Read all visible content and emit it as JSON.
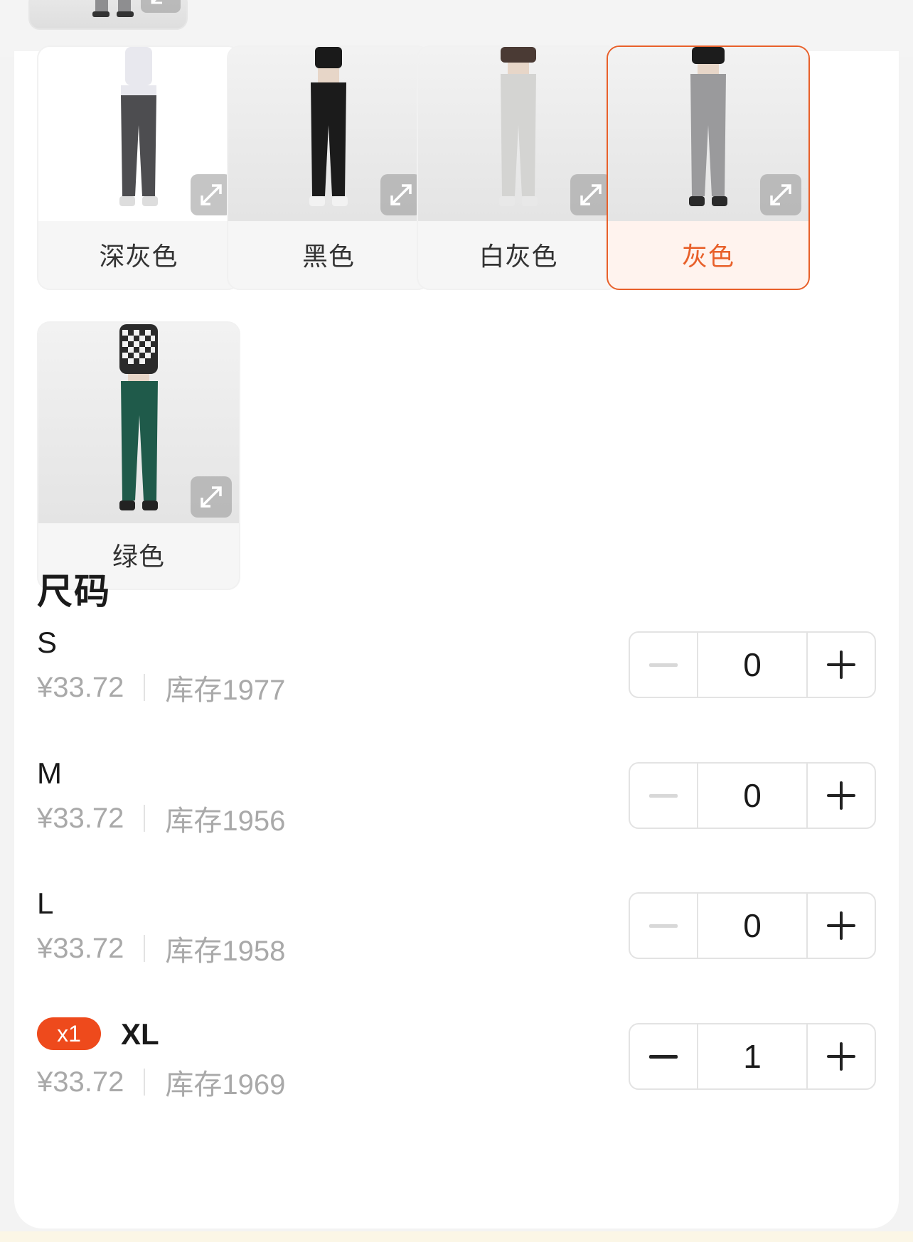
{
  "colors": {
    "accent": "#e8602a",
    "badge": "#ee4a1c",
    "muted_text": "#a9a9a9"
  },
  "color_options": {
    "items": [
      {
        "label": "深灰色",
        "selected": false,
        "pants_color": "#4d4d50",
        "top_color": "#e8e8ee"
      },
      {
        "label": "黑色",
        "selected": false,
        "pants_color": "#1b1b1b",
        "top_color": "#1a1a1a"
      },
      {
        "label": "白灰色",
        "selected": false,
        "pants_color": "#d4d4d2",
        "top_color": "#4a3a34"
      },
      {
        "label": "灰色",
        "selected": true,
        "pants_color": "#9a9a9c",
        "top_color": "#1c1c1c"
      },
      {
        "label": "绿色",
        "selected": false,
        "pants_color": "#1f5a4a",
        "top_color": "#2b2b2b"
      }
    ]
  },
  "size_section": {
    "title": "尺码",
    "rows": [
      {
        "size": "S",
        "price": "¥33.72",
        "stock": "库存1977",
        "quantity": "0",
        "badge": ""
      },
      {
        "size": "M",
        "price": "¥33.72",
        "stock": "库存1956",
        "quantity": "0",
        "badge": ""
      },
      {
        "size": "L",
        "price": "¥33.72",
        "stock": "库存1958",
        "quantity": "0",
        "badge": ""
      },
      {
        "size": "XL",
        "price": "¥33.72",
        "stock": "库存1969",
        "quantity": "1",
        "badge": "x1"
      }
    ]
  }
}
